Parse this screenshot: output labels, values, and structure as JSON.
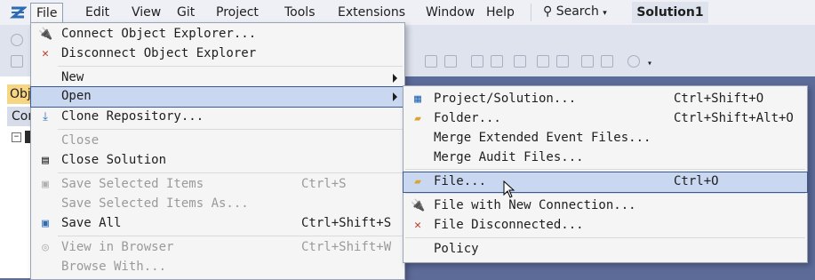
{
  "menubar": {
    "items": [
      "File",
      "Edit",
      "View",
      "Git",
      "Project",
      "Tools",
      "Extensions",
      "Window",
      "Help"
    ],
    "search_label": "Search",
    "solution_name": "Solution1"
  },
  "left_panel": {
    "tab_label": "Obj",
    "row_label": "Con"
  },
  "file_menu": {
    "connect": "Connect Object Explorer...",
    "disconnect": "Disconnect Object Explorer",
    "new": "New",
    "open": "Open",
    "clone": "Clone Repository...",
    "close": "Close",
    "close_solution": "Close Solution",
    "save_selected": "Save Selected Items",
    "save_selected_sc": "Ctrl+S",
    "save_selected_as": "Save Selected Items As...",
    "save_all": "Save All",
    "save_all_sc": "Ctrl+Shift+S",
    "view_browser": "View in Browser",
    "view_browser_sc": "Ctrl+Shift+W",
    "browse_with": "Browse With..."
  },
  "open_menu": {
    "project_solution": "Project/Solution...",
    "project_solution_sc": "Ctrl+Shift+O",
    "folder": "Folder...",
    "folder_sc": "Ctrl+Shift+Alt+O",
    "merge_event": "Merge Extended Event Files...",
    "merge_audit": "Merge Audit Files...",
    "file": "File...",
    "file_sc": "Ctrl+O",
    "file_new_conn": "File with New Connection...",
    "file_disconnected": "File Disconnected...",
    "policy": "Policy"
  },
  "colors": {
    "accent": "#3a5a97",
    "highlight": "#c9d8f0",
    "background": "#5d6b99"
  }
}
